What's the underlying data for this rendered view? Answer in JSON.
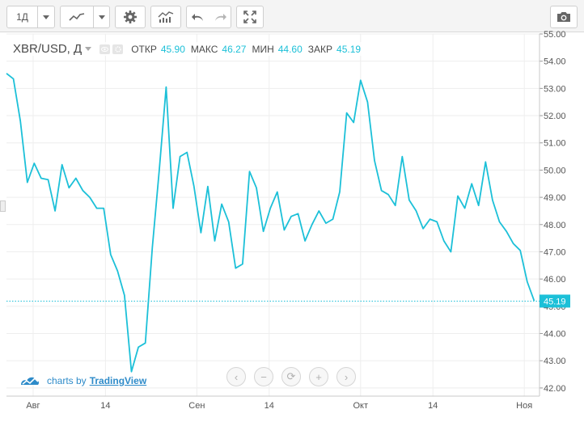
{
  "toolbar": {
    "interval_label": "1Д",
    "chart_style_icon": "line-chart-icon",
    "settings_icon": "gear-icon",
    "indicators_icon": "indicators-icon",
    "undo_icon": "undo-icon",
    "redo_icon": "redo-icon",
    "fullscreen_icon": "fullscreen-icon",
    "snapshot_icon": "camera-icon"
  },
  "legend": {
    "symbol": "XBR/USD, Д",
    "open_label": "ОТКР",
    "open_value": "45.90",
    "high_label": "МАКС",
    "high_value": "46.27",
    "low_label": "МИН",
    "low_value": "44.60",
    "close_label": "ЗАКР",
    "close_value": "45.19"
  },
  "watermark": {
    "prefix": "charts by",
    "brand": "TradingView"
  },
  "colors": {
    "line": "#1cc0d8",
    "grid": "#eeeeee",
    "axis_text": "#555555",
    "price_tag": "#1cc0d8"
  },
  "chart_data": {
    "type": "line",
    "ylim": [
      41.7,
      55.0
    ],
    "y_ticks": [
      "42.00",
      "43.00",
      "44.00",
      "45.00",
      "46.00",
      "47.00",
      "48.00",
      "49.00",
      "50.00",
      "51.00",
      "52.00",
      "53.00",
      "54.00",
      "55.00"
    ],
    "x_range": [
      0,
      70
    ],
    "x_ticks": [
      {
        "label": "Авг",
        "x": 3.5
      },
      {
        "label": "14",
        "x": 13
      },
      {
        "label": "Сен",
        "x": 25
      },
      {
        "label": "14",
        "x": 34.5
      },
      {
        "label": "Окт",
        "x": 46.5
      },
      {
        "label": "14",
        "x": 56
      },
      {
        "label": "Ноя",
        "x": 68
      }
    ],
    "last_price": "45.19",
    "series": [
      {
        "y": [
          53.55,
          53.35,
          51.8,
          49.55,
          50.25,
          49.7,
          49.65,
          48.5,
          50.2,
          49.35,
          49.7,
          49.25,
          49.0,
          48.6,
          48.6,
          46.9,
          46.3,
          45.4,
          42.6,
          43.5,
          43.65,
          47.15,
          50.0,
          53.05,
          48.6,
          50.5,
          50.65,
          49.4,
          47.7,
          49.4,
          47.4,
          48.75,
          48.1,
          46.4,
          46.55,
          49.95,
          49.35,
          47.75,
          48.6,
          49.2,
          47.8,
          48.3,
          48.4,
          47.4,
          48.0,
          48.5,
          48.05,
          48.2,
          49.2,
          52.1,
          51.75,
          53.3,
          52.5,
          50.35,
          49.25,
          49.1,
          48.7,
          50.5,
          48.9,
          48.5,
          47.85,
          48.2,
          48.1,
          47.4,
          47.0,
          49.05,
          48.6,
          49.5,
          48.7,
          50.3,
          48.9,
          48.1,
          47.75,
          47.3,
          47.05,
          45.9,
          45.2
        ]
      }
    ]
  }
}
